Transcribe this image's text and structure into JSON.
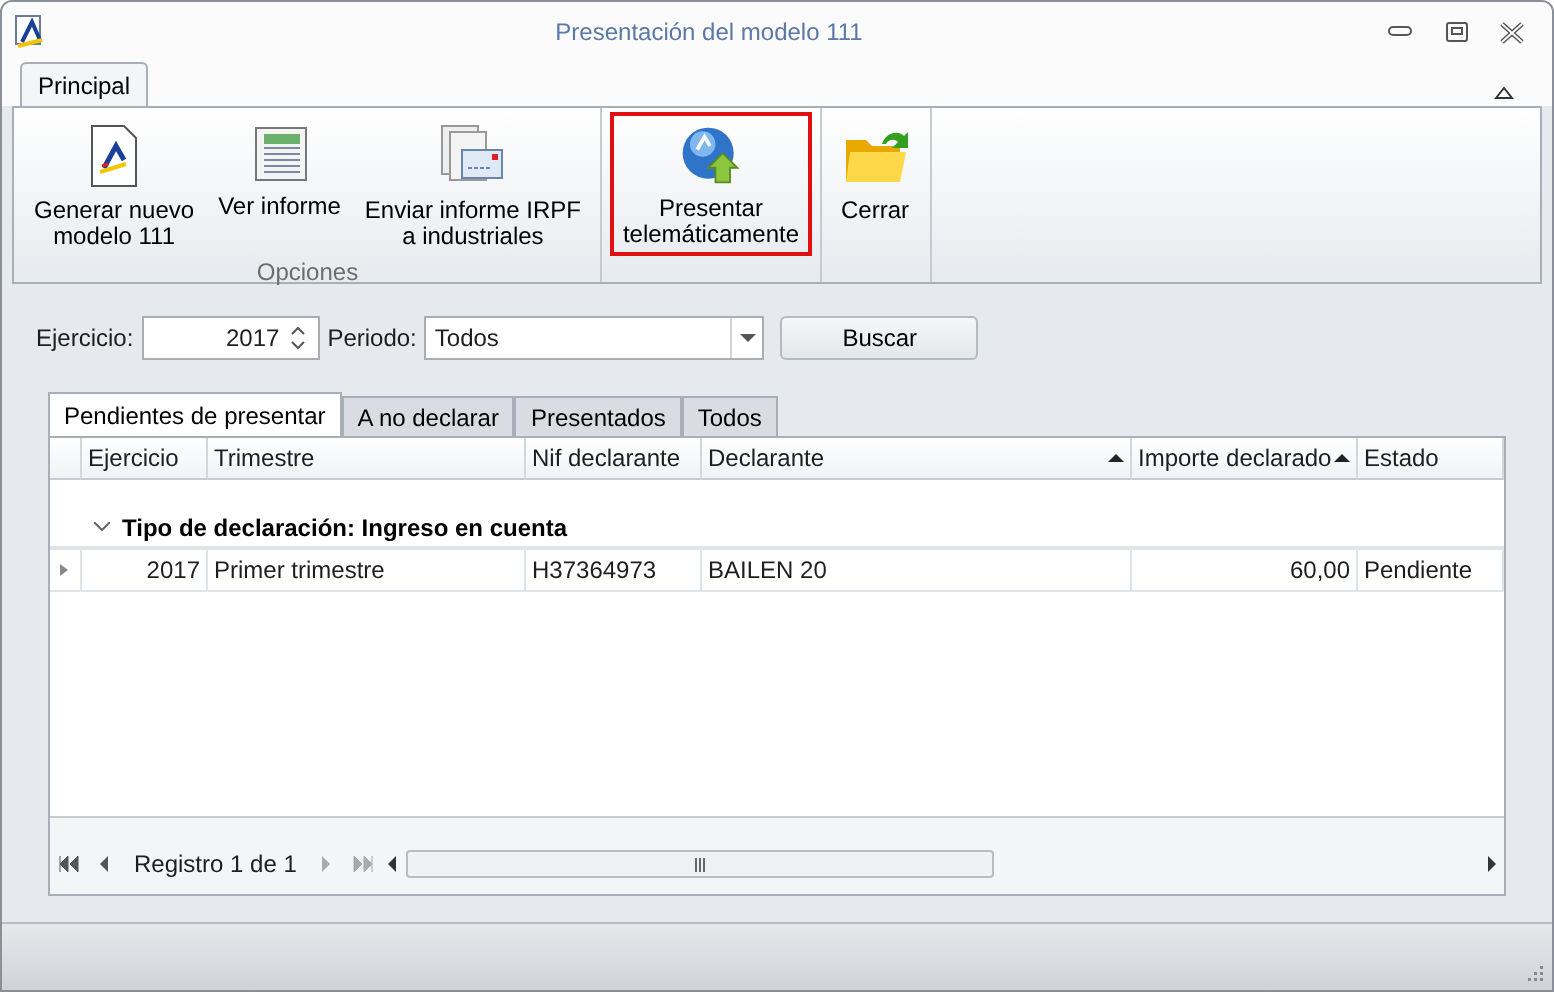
{
  "window": {
    "title": "Presentación del modelo 111"
  },
  "ribbon_tabs": [
    {
      "label": "Principal",
      "selected": true
    }
  ],
  "ribbon_groups": [
    {
      "label": "Opciones",
      "buttons": [
        {
          "kind": "document",
          "label": "Generar nuevo\nmodelo 111",
          "highlighted": false
        },
        {
          "kind": "report",
          "label": "Ver informe",
          "highlighted": false
        },
        {
          "kind": "mail",
          "label": "Enviar informe IRPF\na industriales",
          "highlighted": false
        }
      ]
    },
    {
      "buttons": [
        {
          "kind": "upload",
          "label": "Presentar\ntelemáticamente",
          "highlighted": true
        }
      ]
    },
    {
      "buttons": [
        {
          "kind": "folder",
          "label": "Cerrar",
          "highlighted": false
        }
      ]
    }
  ],
  "filters": {
    "ejercicio_label": "Ejercicio:",
    "ejercicio": "2017",
    "periodo_label": "Periodo:",
    "periodo": "Todos",
    "search_button": "Buscar"
  },
  "tabs": [
    {
      "label": "Pendientes de presentar",
      "selected": true
    },
    {
      "label": "A no declarar",
      "selected": false
    },
    {
      "label": "Presentados",
      "selected": false
    },
    {
      "label": "Todos",
      "selected": false
    }
  ],
  "table": {
    "columns": [
      {
        "label": "Ejercicio",
        "sorted": false
      },
      {
        "label": "Trimestre",
        "sorted": false
      },
      {
        "label": "Nif declarante",
        "sorted": false
      },
      {
        "label": "Declarante",
        "sorted": true
      },
      {
        "label": "Importe declarado",
        "sorted": true
      },
      {
        "label": "Estado",
        "sorted": false
      }
    ],
    "groups": [
      {
        "label": "Tipo de declaración: Ingreso en cuenta",
        "expanded": true,
        "rows": [
          {
            "cells": [
              "2017",
              "Primer trimestre",
              "H37364973",
              "BAILEN 20",
              "60,00",
              "Pendiente"
            ],
            "selected": false
          }
        ]
      }
    ]
  },
  "navigator": {
    "text": "Registro 1 de 1",
    "can_prev": false,
    "can_next": false
  }
}
